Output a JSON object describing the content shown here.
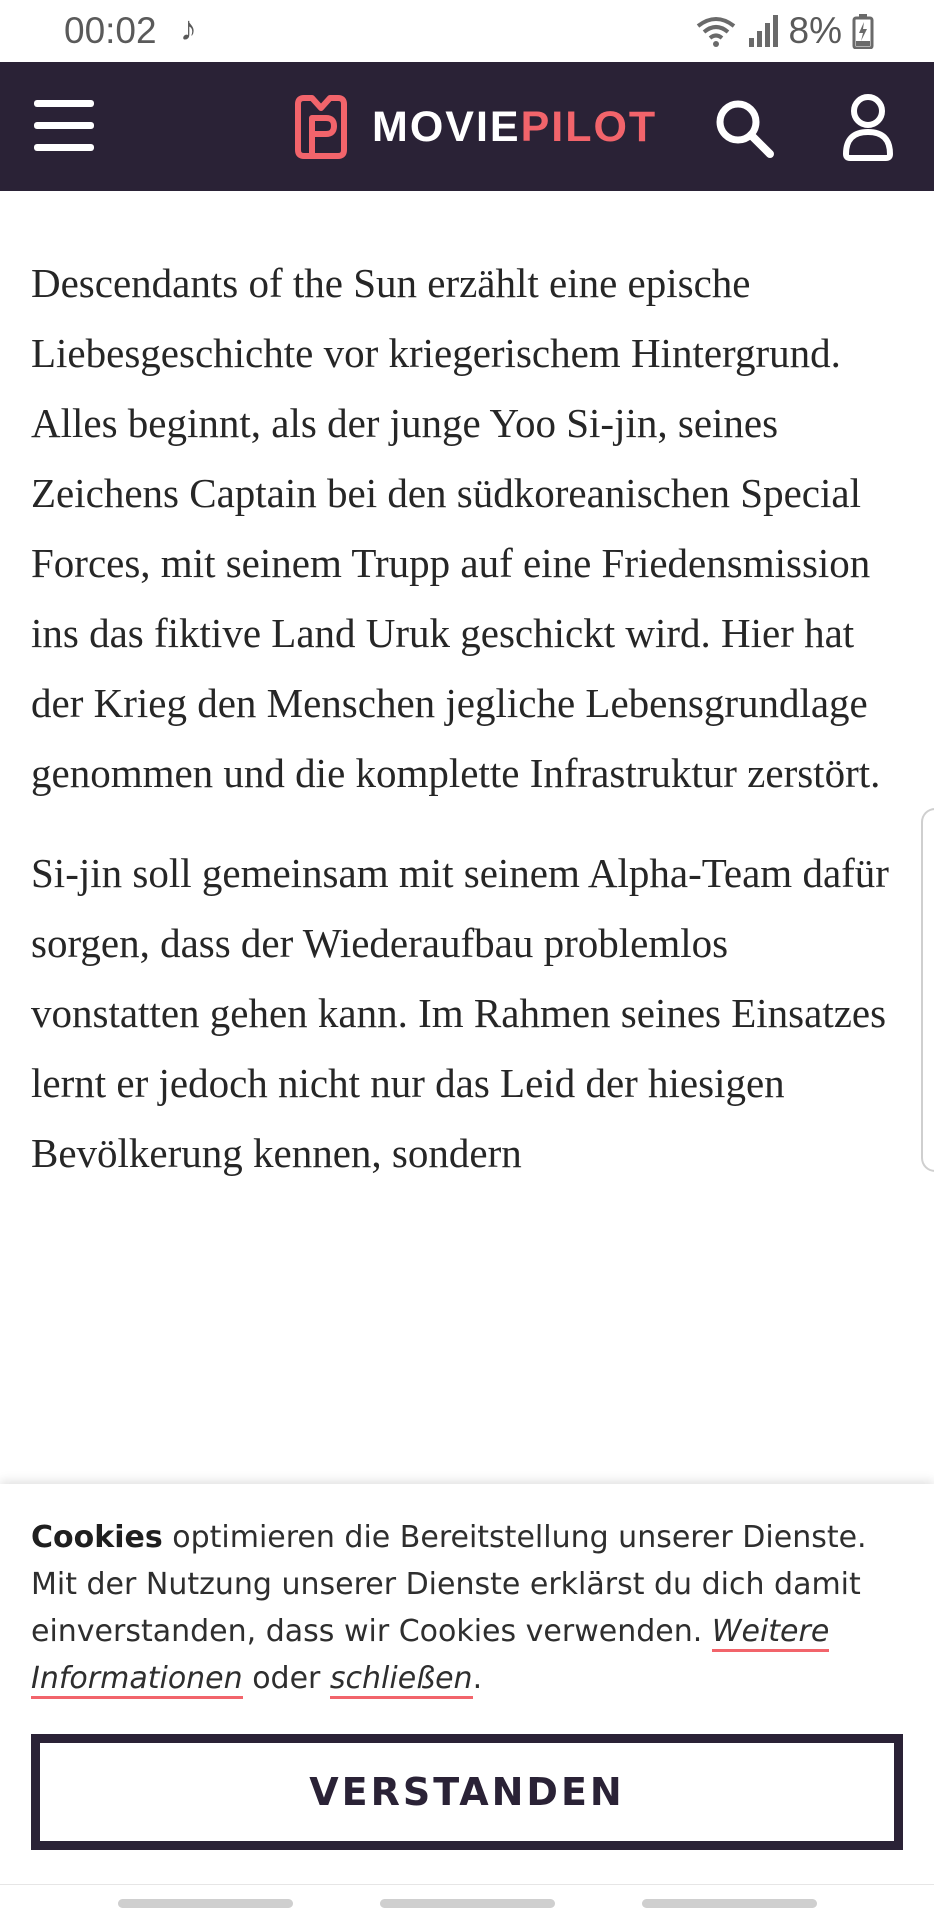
{
  "status": {
    "time": "00:02",
    "battery": "8%",
    "note_icon": "music-note-icon",
    "wifi_icon": "wifi-icon",
    "signal_icon": "signal-icon",
    "battery_icon": "battery-charging-icon"
  },
  "header": {
    "logo_part1": "MOVIE",
    "logo_part2": "PILOT",
    "menu_icon": "hamburger-menu-icon",
    "search_icon": "search-icon",
    "user_icon": "user-icon",
    "bg_color": "#2a2236",
    "accent_color": "#f2646b"
  },
  "article": {
    "paragraphs": [
      "Descendants of the Sun erzählt eine epische Liebesgeschichte vor kriegerischem Hintergrund. Alles beginnt, als der junge Yoo Si-jin, seines Zeichens Captain bei den südkoreanischen Special Forces, mit seinem Trupp auf eine Friedensmission ins das fiktive Land Uruk geschickt wird. Hier hat der Krieg den Menschen jegliche Lebensgrundlage genommen und die komplette Infrastruktur zerstört.",
      "Si-jin soll gemeinsam mit seinem Alpha-Team dafür sorgen, dass der Wiederaufbau problemlos vonstatten gehen kann. Im Rahmen seines Einsatzes lernt er jedoch nicht nur das Leid der hiesigen Bevölkerung kennen, sondern"
    ]
  },
  "cookie": {
    "bold": "Cookies",
    "text": " optimieren die Bereitstellung unserer Dienste. Mit der Nutzung unserer Dienste erklärst du dich damit einverstanden, dass wir Cookies verwenden. ",
    "link_more": "Weitere Informationen",
    "between": " oder ",
    "link_close": "schließen",
    "end": ".",
    "button": "VERSTANDEN"
  }
}
